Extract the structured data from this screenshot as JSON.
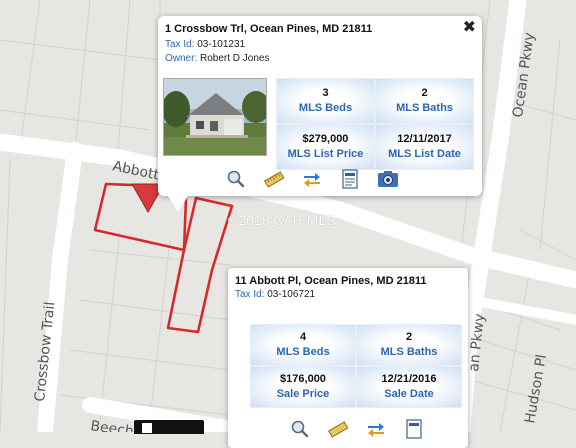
{
  "streets": {
    "abbott": "Abbott",
    "ocean_pkwy": "Ocean Pkwy",
    "ocean_pkwy_partial": "an Pkwy",
    "crossbow_trail": "Crossbow Trail",
    "hudson": "Hudson Pl",
    "beech_partial": "Beech"
  },
  "watermark": "©2018 CAR MLS",
  "popups": [
    {
      "address": "1 Crossbow Trl, Ocean Pines, MD 21811",
      "tax_id_label": "Tax Id:",
      "tax_id": "03-101231",
      "owner_label": "Owner:",
      "owner": "Robert D Jones",
      "close_label": "✖",
      "stats": [
        {
          "value": "3",
          "label": "MLS Beds"
        },
        {
          "value": "2",
          "label": "MLS Baths"
        },
        {
          "value": "$279,000",
          "label": "MLS List Price"
        },
        {
          "value": "12/11/2017",
          "label": "MLS List Date"
        }
      ],
      "tools": [
        "magnifier-icon",
        "ruler-icon",
        "transfer-arrows-icon",
        "document-icon",
        "camera-icon"
      ]
    },
    {
      "address": "11 Abbott Pl, Ocean Pines, MD 21811",
      "tax_id_label": "Tax Id:",
      "tax_id": "03-106721",
      "stats": [
        {
          "value": "4",
          "label": "MLS Beds"
        },
        {
          "value": "2",
          "label": "MLS Baths"
        },
        {
          "value": "$176,000",
          "label": "Sale Price"
        },
        {
          "value": "12/21/2016",
          "label": "Sale Date"
        }
      ],
      "tools": [
        "magnifier-icon",
        "ruler-icon",
        "transfer-arrows-icon",
        "document-icon"
      ]
    }
  ],
  "colors": {
    "parcel_outline": "#d42a2a",
    "link_blue": "#2a66b0",
    "map_background": "#e8e6e3",
    "road": "#ffffff"
  }
}
